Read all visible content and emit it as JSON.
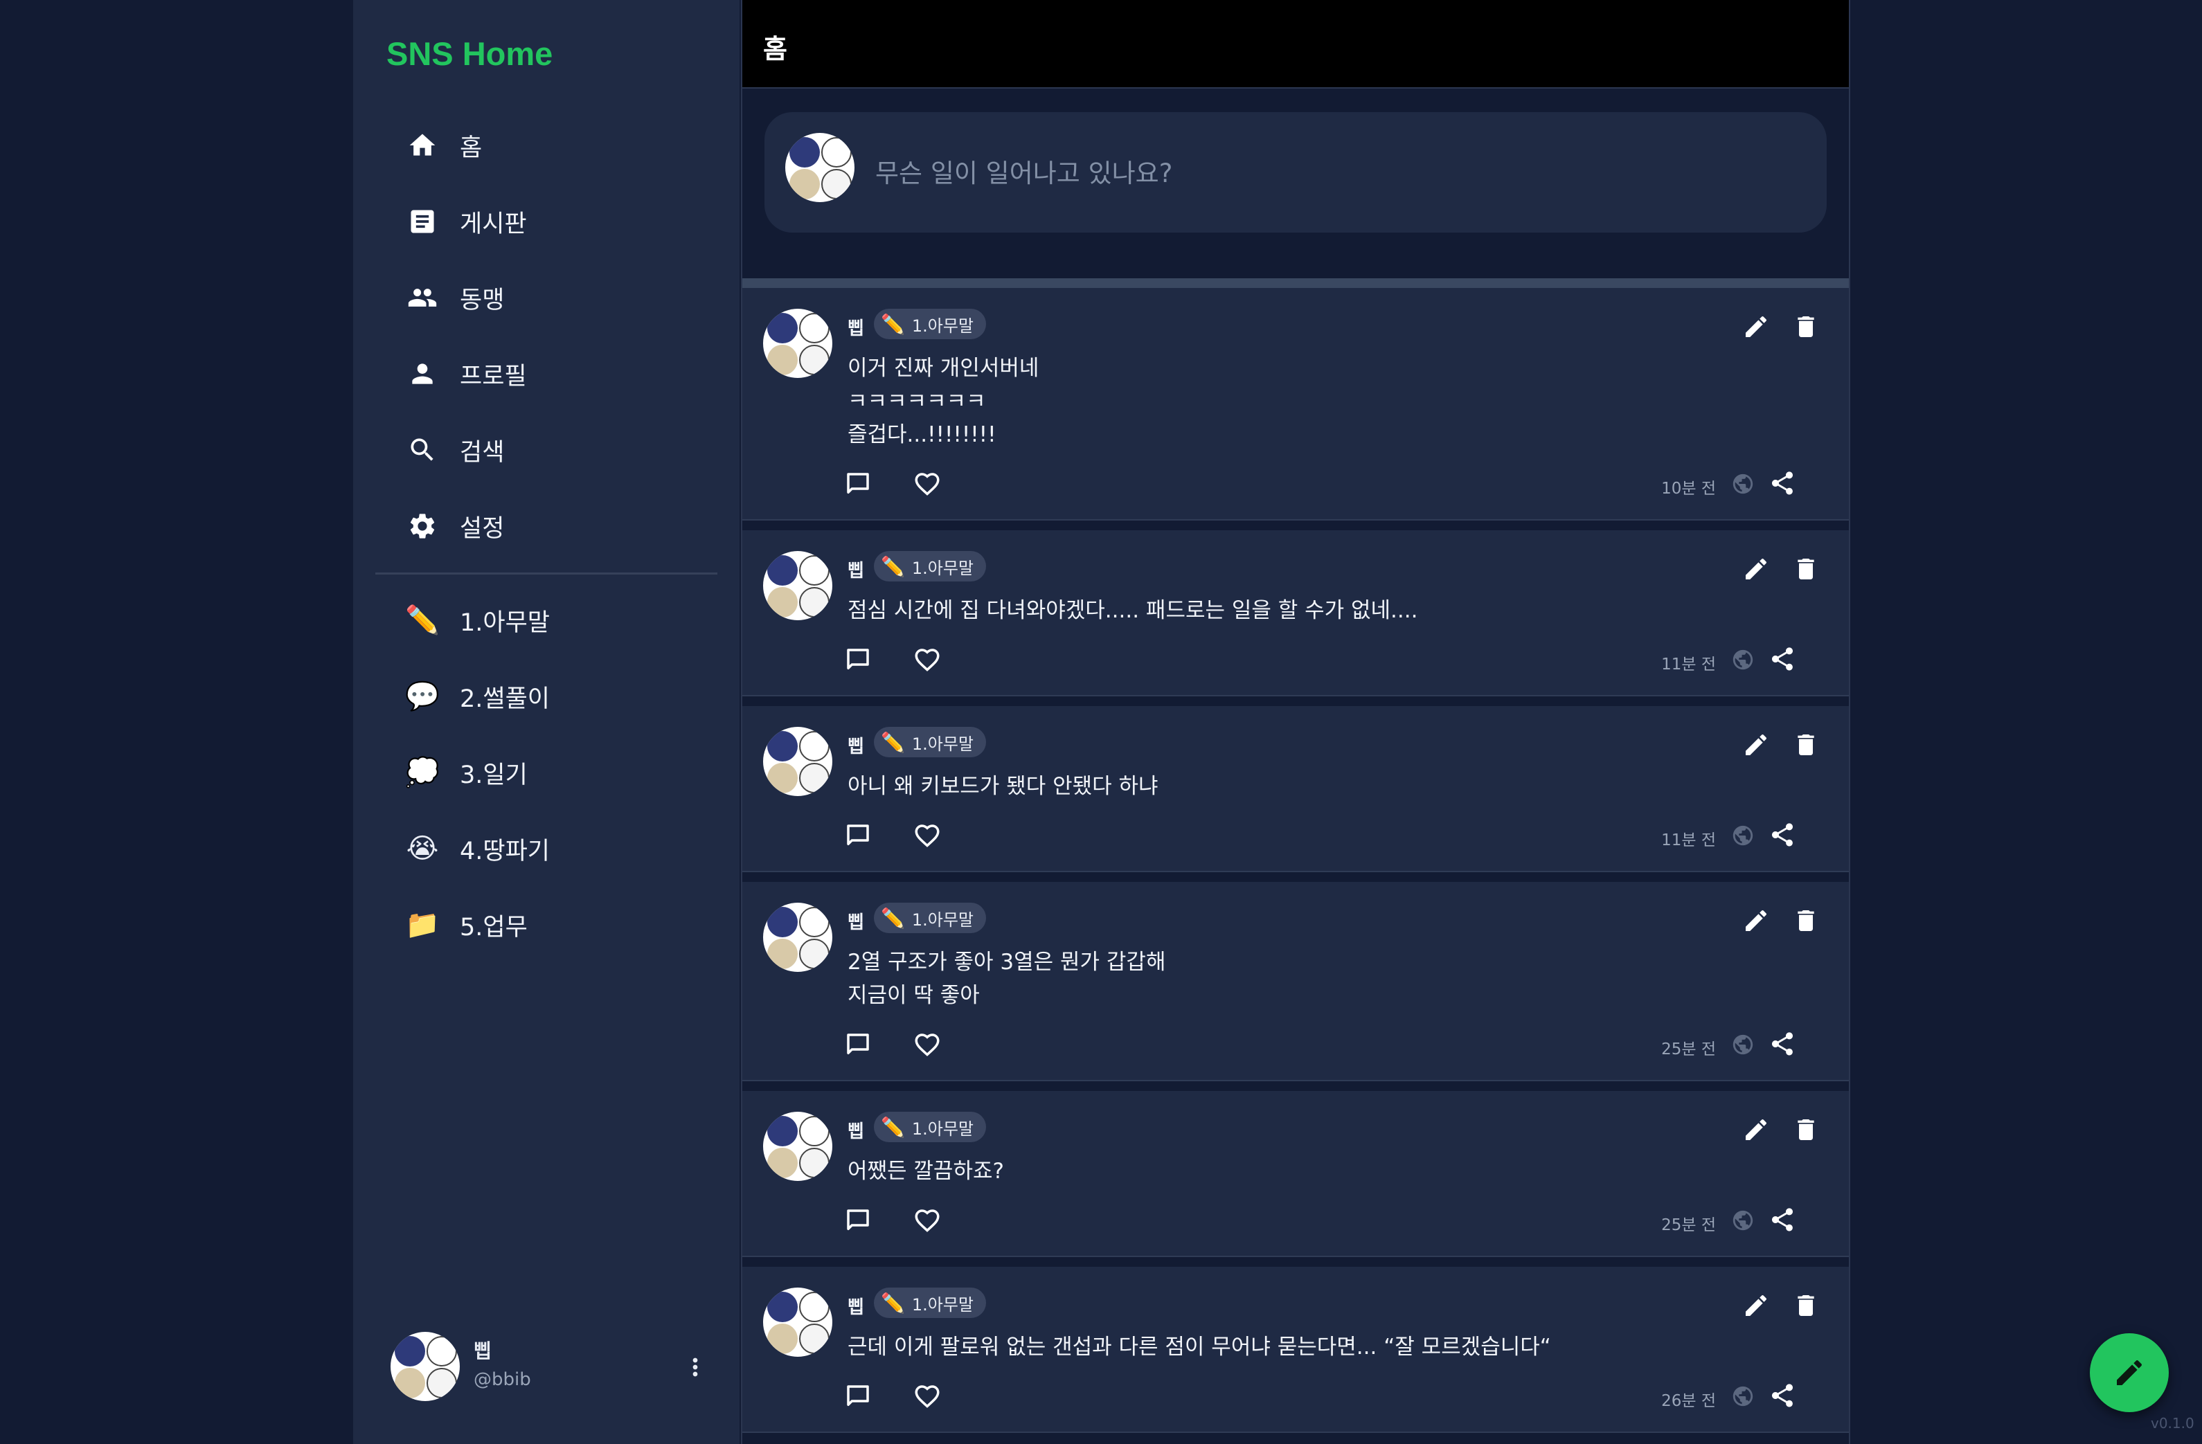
{
  "app": {
    "brand": "SNS Home",
    "version": "v0.1.0"
  },
  "sidebar": {
    "nav": [
      {
        "label": "홈",
        "icon": "home-icon"
      },
      {
        "label": "게시판",
        "icon": "board-icon"
      },
      {
        "label": "동맹",
        "icon": "people-icon"
      },
      {
        "label": "프로필",
        "icon": "person-icon"
      },
      {
        "label": "검색",
        "icon": "search-icon"
      },
      {
        "label": "설정",
        "icon": "gear-icon"
      }
    ],
    "boards": [
      {
        "label": "1.아무말",
        "emoji": "✏️"
      },
      {
        "label": "2.썰풀이",
        "emoji": "💬"
      },
      {
        "label": "3.일기",
        "emoji": "💭"
      },
      {
        "label": "4.땅파기",
        "emoji": "😭"
      },
      {
        "label": "5.업무",
        "emoji": "📁"
      }
    ],
    "account": {
      "name": "삡",
      "handle": "@bbib"
    }
  },
  "main": {
    "title": "홈",
    "composer": {
      "placeholder": "무슨 일이 일어나고 있나요?"
    },
    "posts": [
      {
        "author": "삡",
        "tag_emoji": "✏️",
        "tag": "1.아무말",
        "content": "이거 진짜 개인서버네\nㅋㅋㅋㅋㅋㅋㅋ\n즐겁다...!!!!!!!!",
        "time": "10분 전"
      },
      {
        "author": "삡",
        "tag_emoji": "✏️",
        "tag": "1.아무말",
        "content": "점심 시간에 집 다녀와야겠다..... 패드로는 일을 할 수가 없네....",
        "time": "11분 전"
      },
      {
        "author": "삡",
        "tag_emoji": "✏️",
        "tag": "1.아무말",
        "content": "아니 왜 키보드가 됐다 안됐다 하냐",
        "time": "11분 전"
      },
      {
        "author": "삡",
        "tag_emoji": "✏️",
        "tag": "1.아무말",
        "content": "2열 구조가 좋아 3열은 뭔가 갑갑해\n지금이 딱 좋아",
        "time": "25분 전"
      },
      {
        "author": "삡",
        "tag_emoji": "✏️",
        "tag": "1.아무말",
        "content": "어쨌든 깔끔하죠?",
        "time": "25분 전"
      },
      {
        "author": "삡",
        "tag_emoji": "✏️",
        "tag": "1.아무말",
        "content": "근데 이게 팔로워 없는 갠섭과 다른 점이 무어냐 묻는다면... “잘 모르겠습니다“",
        "time": "26분 전"
      }
    ]
  }
}
